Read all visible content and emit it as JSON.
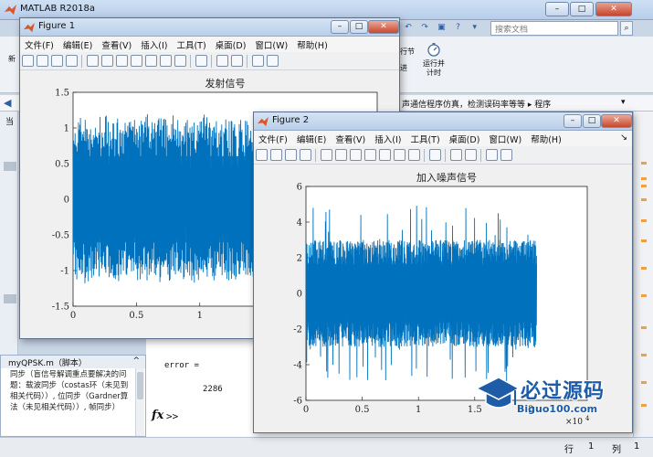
{
  "app": {
    "title": "MATLAB R2018a",
    "search_placeholder": "搜索文档"
  },
  "ribbon": {
    "items": [
      {
        "label": "新"
      },
      {
        "label": "行节"
      },
      {
        "label": "进"
      },
      {
        "label": "运行并\n计时"
      }
    ]
  },
  "path": {
    "text": "声通信程序仿真，检测误码率等等 ▸ 程序"
  },
  "left_panel": {
    "label": "当"
  },
  "file_panel": {
    "header": "myQPSK.m（脚本）",
    "description": "同步（盲信号解调重点要解决的问题：载波同步（costas环（未见到相关代码））, 位同步（Gardner算法（未见相关代码））, 帧同步）"
  },
  "command_window": {
    "var_line": "error =",
    "value": "2286",
    "prompt": ">>"
  },
  "status": {
    "row_label": "行",
    "row_value": "1",
    "col_label": "列",
    "col_value": "1"
  },
  "figure1": {
    "title": "Figure 1",
    "menu": [
      "文件(F)",
      "编辑(E)",
      "查看(V)",
      "插入(I)",
      "工具(T)",
      "桌面(D)",
      "窗口(W)",
      "帮助(H)"
    ]
  },
  "figure2": {
    "title": "Figure 2",
    "menu": [
      "文件(F)",
      "编辑(E)",
      "查看(V)",
      "插入(I)",
      "工具(T)",
      "桌面(D)",
      "窗口(W)",
      "帮助(H)"
    ]
  },
  "chart_data": [
    {
      "type": "line",
      "title": "发射信号",
      "xlim": [
        0,
        2.4
      ],
      "ylim": [
        -1.5,
        1.5
      ],
      "xticks": [
        "0",
        "0.5",
        "1",
        "1.5"
      ],
      "yticks": [
        "1.5",
        "1",
        "0.5",
        "0",
        "-0.5",
        "-1",
        "-1.5"
      ],
      "series": [
        {
          "envelope_min": -1.1,
          "envelope_max": 1.1,
          "x_range": [
            0,
            2.4
          ],
          "color": "#0072bd"
        }
      ]
    },
    {
      "type": "line",
      "title": "加入噪声信号",
      "xlim": [
        0,
        2.5
      ],
      "ylim": [
        -6,
        6
      ],
      "xticks": [
        "0",
        "0.5",
        "1",
        "1.5",
        "2"
      ],
      "yticks": [
        "6",
        "4",
        "2",
        "0",
        "-2",
        "-4",
        "-6"
      ],
      "x_multiplier": "×10",
      "x_multiplier_exp": "4",
      "series": [
        {
          "envelope_min": -3.0,
          "envelope_max": 3.0,
          "x_range": [
            0,
            2.05
          ],
          "color": "#0072bd"
        }
      ]
    }
  ],
  "watermark": {
    "name": "必过源码",
    "url": "Biguo100.com"
  }
}
